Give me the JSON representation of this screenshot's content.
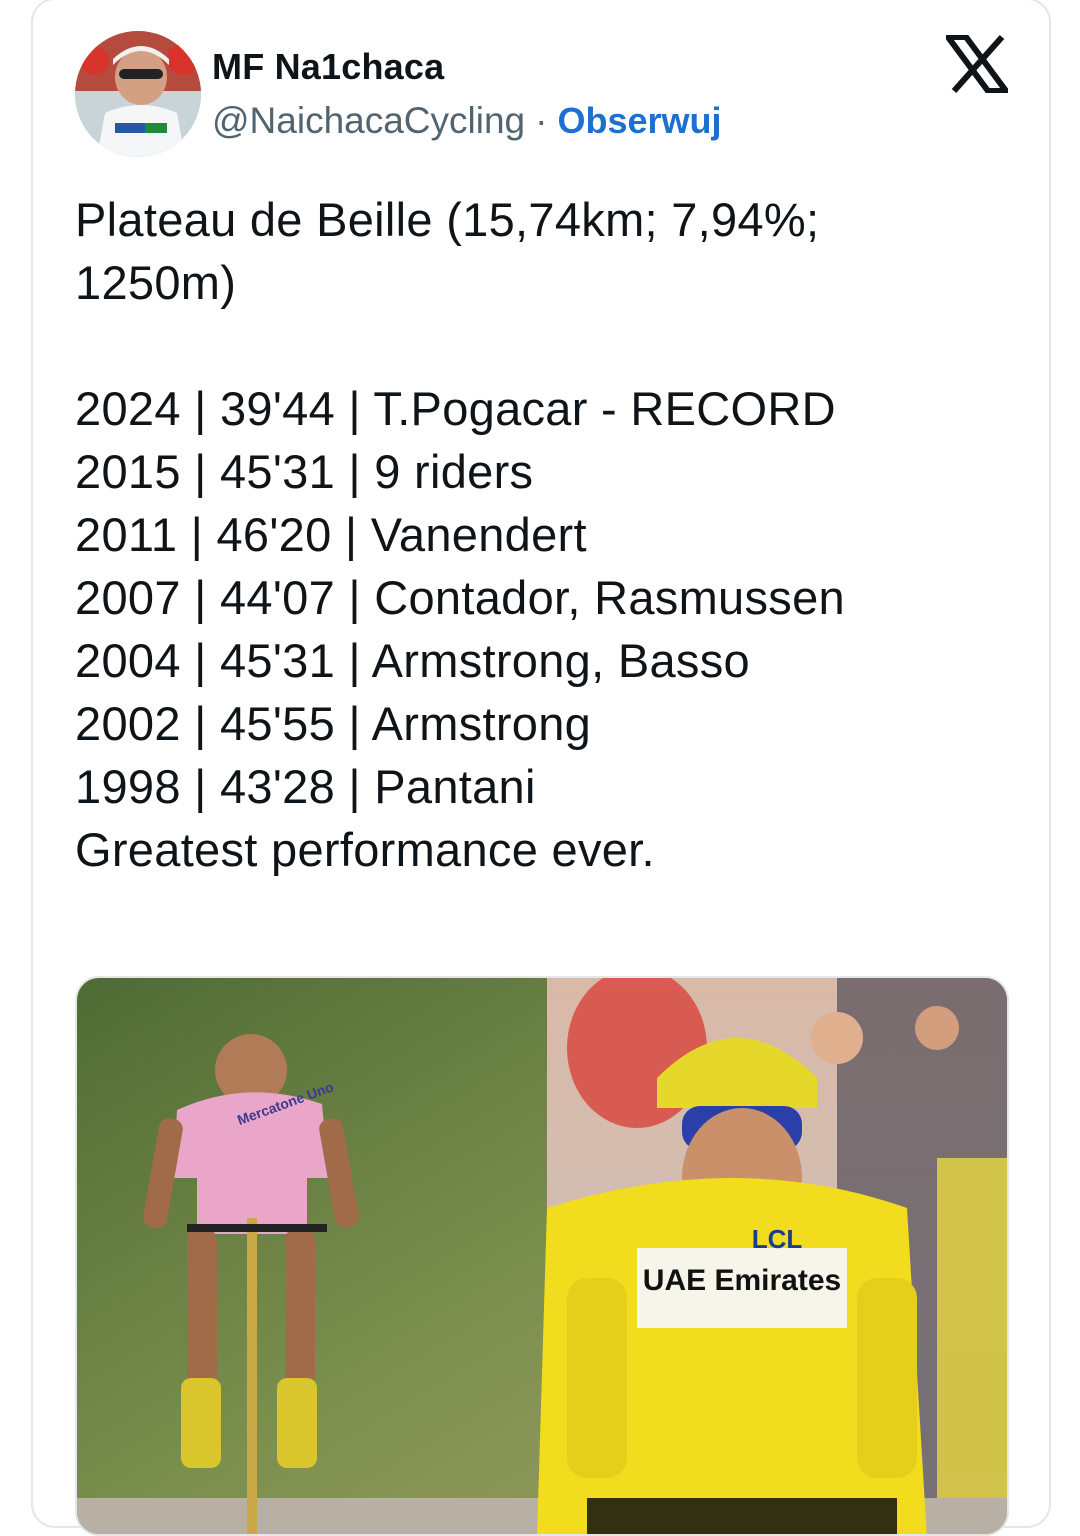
{
  "author": {
    "display_name": "MF Na1chaca",
    "handle": "@NaichacaCycling",
    "separator": "·",
    "follow_label": "Obserwuj",
    "avatar_icon": "profile-photo-cyclist"
  },
  "platform_icon": "x-logo-icon",
  "tweet": {
    "title_line1": "Plateau de Beille (15,74km; 7,94%;",
    "title_line2": "1250m)",
    "rows": [
      "2024 | 39'44 | T.Pogacar - RECORD",
      "2015 | 45'31 | 9 riders",
      "2011 | 46'20 | Vanendert",
      "2007 | 44'07 | Contador, Rasmussen",
      "2004 | 45'31 | Armstrong,  Basso",
      "2002 | 45'55 | Armstrong",
      "1998 | 43'28 | Pantani"
    ],
    "closing": "Greatest performance ever."
  },
  "media": {
    "jersey_left_text": "Mercatone Uno",
    "jersey_right_text": "UAE Emirates",
    "sponsor_text": "LCL",
    "colors": {
      "pink_jersey": "#e9a6c9",
      "yellow_jersey": "#f2dc1e",
      "background_green": "#5e7a3e"
    }
  },
  "colors": {
    "text": "#0f1419",
    "secondary": "#536471",
    "follow": "#1d6fd0",
    "border": "#e4e6e9"
  }
}
